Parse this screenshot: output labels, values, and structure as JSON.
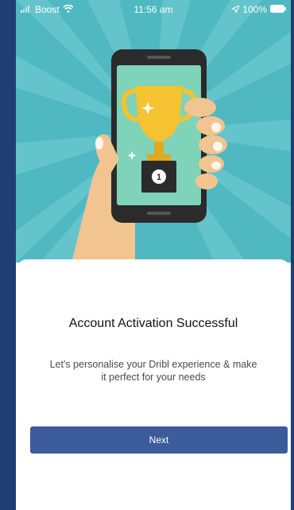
{
  "status_bar": {
    "carrier": "Boost",
    "time": "11:56 am",
    "battery": "100%",
    "icons": [
      "signal-icon",
      "wifi-icon",
      "location-arrow-icon",
      "battery-icon"
    ]
  },
  "hero": {
    "illustration": "hand-holding-phone-with-trophy",
    "trophy_badge": "1",
    "colors": {
      "background": "#4fb8c1",
      "rays": "#6cc9cf",
      "trophy": "#f5c231"
    }
  },
  "content": {
    "title": "Account Activation Successful",
    "description": "Let's personalise your Dribl experience & make it perfect for your needs"
  },
  "actions": {
    "next_label": "Next"
  },
  "colors": {
    "frame": "#1f3f73",
    "button": "#3b5b9b"
  }
}
